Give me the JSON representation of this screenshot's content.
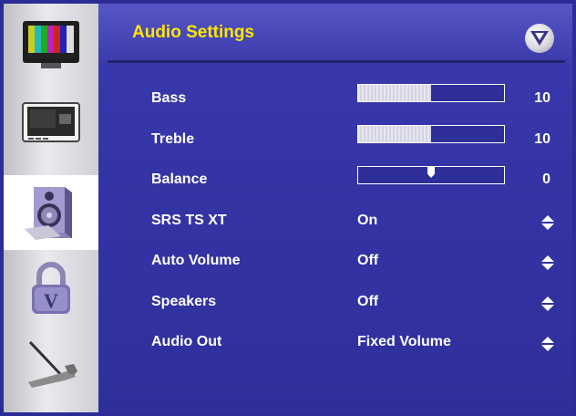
{
  "menu": {
    "title": "Audio Settings",
    "logo_icon": "vizio-v-logo",
    "title_color": "#ffe600"
  },
  "sidebar": {
    "items": [
      {
        "name": "picture-menu",
        "icon": "color-bars-tv-icon",
        "active": false
      },
      {
        "name": "input-menu",
        "icon": "tv-screen-icon",
        "active": false
      },
      {
        "name": "audio-menu",
        "icon": "speaker-icon",
        "active": true
      },
      {
        "name": "parental-menu",
        "icon": "lock-icon",
        "active": false
      },
      {
        "name": "setup-menu",
        "icon": "wrench-icon",
        "active": false
      }
    ]
  },
  "settings": {
    "bass": {
      "label": "Bass",
      "value": "10",
      "level": 0.5
    },
    "treble": {
      "label": "Treble",
      "value": "10",
      "level": 0.5
    },
    "balance": {
      "label": "Balance",
      "value": "0",
      "position": 0.5
    },
    "srs": {
      "label": "SRS TS XT",
      "value": "On",
      "icon": "up-down-arrows-icon"
    },
    "auto_volume": {
      "label": "Auto Volume",
      "value": "Off",
      "icon": "up-down-arrows-icon"
    },
    "speakers": {
      "label": "Speakers",
      "value": "Off",
      "icon": "up-down-arrows-icon"
    },
    "audio_out": {
      "label": "Audio Out",
      "value": "Fixed Volume",
      "icon": "up-down-arrows-icon"
    }
  }
}
